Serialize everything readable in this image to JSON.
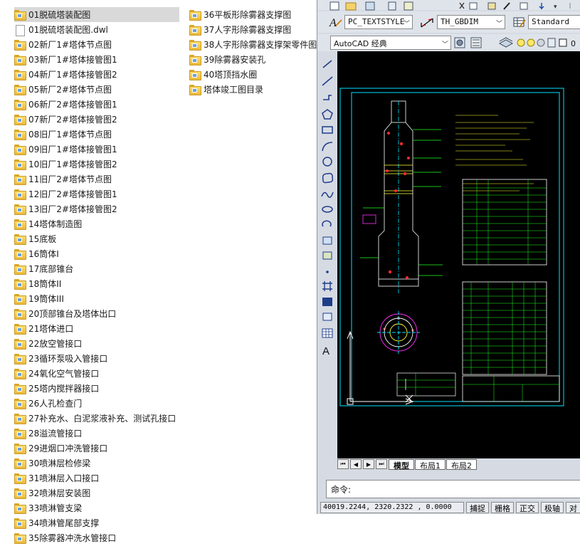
{
  "file_list": {
    "left_column": [
      {
        "label": "01脱硫塔装配图",
        "type": "folder",
        "selected": true
      },
      {
        "label": "01脱硫塔装配图.dwl",
        "type": "file"
      },
      {
        "label": "02新厂1#塔体节点图",
        "type": "folder"
      },
      {
        "label": "03新厂1#塔体接管图1",
        "type": "folder"
      },
      {
        "label": "04新厂1#塔体接管图2",
        "type": "folder"
      },
      {
        "label": "05新厂2#塔体节点图",
        "type": "folder"
      },
      {
        "label": "06新厂2#塔体接管图1",
        "type": "folder"
      },
      {
        "label": "07新厂2#塔体接管图2",
        "type": "folder"
      },
      {
        "label": "08旧厂1#塔体节点图",
        "type": "folder"
      },
      {
        "label": "09旧厂1#塔体接管图1",
        "type": "folder"
      },
      {
        "label": "10旧厂1#塔体接管图2",
        "type": "folder"
      },
      {
        "label": "11旧厂2#塔体节点图",
        "type": "folder"
      },
      {
        "label": "12旧厂2#塔体接管图1",
        "type": "folder"
      },
      {
        "label": "13旧厂2#塔体接管图2",
        "type": "folder"
      },
      {
        "label": "14塔体制造图",
        "type": "folder"
      },
      {
        "label": "15底板",
        "type": "folder"
      },
      {
        "label": "16筒体I",
        "type": "folder"
      },
      {
        "label": "17底部锥台",
        "type": "folder"
      },
      {
        "label": "18筒体II",
        "type": "folder"
      },
      {
        "label": "19筒体III",
        "type": "folder"
      },
      {
        "label": "20顶部锥台及塔体出口",
        "type": "folder"
      },
      {
        "label": "21塔体进口",
        "type": "folder"
      },
      {
        "label": "22放空管接口",
        "type": "folder"
      },
      {
        "label": "23循环泵吸入管接口",
        "type": "folder"
      },
      {
        "label": "24氧化空气管接口",
        "type": "folder"
      },
      {
        "label": "25塔内搅拌器接口",
        "type": "folder"
      },
      {
        "label": "26人孔检查门",
        "type": "folder"
      },
      {
        "label": "27补充水、白泥浆液补充、测试孔接口",
        "type": "folder"
      },
      {
        "label": "28溢流管接口",
        "type": "folder"
      },
      {
        "label": "29进烟口冲洗管接口",
        "type": "folder"
      },
      {
        "label": "30喷淋层检修梁",
        "type": "folder"
      },
      {
        "label": "31喷淋层入口接口",
        "type": "folder"
      },
      {
        "label": "32喷淋层安装图",
        "type": "folder"
      },
      {
        "label": "33喷淋管支梁",
        "type": "folder"
      },
      {
        "label": "34喷淋管尾部支撑",
        "type": "folder"
      },
      {
        "label": "35除雾器冲洗水管接口",
        "type": "folder"
      }
    ],
    "right_column": [
      {
        "label": "36平板形除雾器支撑图",
        "type": "folder"
      },
      {
        "label": "37人字形除雾器支撑图",
        "type": "folder"
      },
      {
        "label": "38人字形除雾器支撑架零件图",
        "type": "folder"
      },
      {
        "label": "39除雾器安装孔",
        "type": "folder"
      },
      {
        "label": "40塔顶挡水圈",
        "type": "folder"
      },
      {
        "label": "塔体竣工图目录",
        "type": "folder"
      }
    ]
  },
  "cad": {
    "text_style_combo": "PC_TEXTSTYLE",
    "dim_style_combo": "TH_GBDIM",
    "table_style_combo": "Standard",
    "workspace_combo": "AutoCAD 经典",
    "layer_value": "0",
    "layout_tabs": [
      "模型",
      "布局1",
      "布局2"
    ],
    "command_prompt": "命令:",
    "coordinates": "40019.2244,  2320.2322 , 0.0000",
    "status_buttons": [
      "捕捉",
      "栅格",
      "正交",
      "极轴",
      "对"
    ],
    "icons": {
      "text_style": "text-style-icon",
      "dim_style": "dimension-style-icon",
      "table_style": "table-style-icon",
      "workspace_settings": "workspace-settings-icon",
      "layer_manager": "layer-manager-icon"
    },
    "colors": {
      "canvas_bg": "#000000",
      "drawing_cyan": "#00e5ff",
      "drawing_white": "#ffffff",
      "drawing_green": "#22ff22",
      "drawing_magenta": "#ff33ff",
      "drawing_yellow": "#ffff33",
      "drawing_red": "#ff2a2a"
    }
  }
}
